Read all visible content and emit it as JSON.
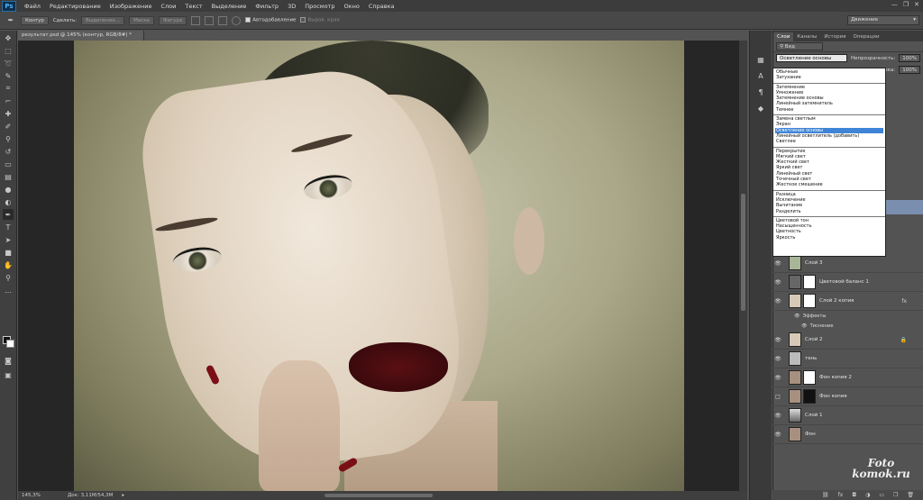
{
  "app": {
    "logo": "Ps"
  },
  "menu": [
    "Файл",
    "Редактирование",
    "Изображение",
    "Слои",
    "Текст",
    "Выделение",
    "Фильтр",
    "3D",
    "Просмотр",
    "Окно",
    "Справка"
  ],
  "window_controls": [
    "—",
    "❐",
    "✕"
  ],
  "options": {
    "mode": "Контур",
    "make_label": "Сделать:",
    "selection": "Выделение...",
    "mask": "Маска",
    "shape": "Фигура",
    "autoadd": "Автодобавление",
    "align_edges": "Выров. края",
    "workspace": "Движение"
  },
  "document": {
    "tab": "результат.psd @ 145% (контур, RGB/8#) *",
    "zoom": "145,3%",
    "doc_info": "Док: 3,11M/54,3M"
  },
  "panel": {
    "tabs": [
      "Слои",
      "Каналы",
      "История",
      "Операции"
    ],
    "filter": "Вид",
    "blend_mode": "Осветление основы",
    "opacity_label": "Непрозрачность:",
    "opacity": "100%",
    "fill_label": "Заливка:",
    "fill": "100%"
  },
  "blend_groups": [
    [
      "Обычные",
      "Затухание"
    ],
    [
      "Затемнение",
      "Умножение",
      "Затемнение основы",
      "Линейный затемнитель",
      "Темнее"
    ],
    [
      "Замена светлым",
      "Экран",
      "Осветление основы",
      "Линейный осветлитель (добавить)",
      "Светлее"
    ],
    [
      "Перекрытие",
      "Мягкий свет",
      "Жесткий свет",
      "Яркий свет",
      "Линейный свет",
      "Точечный свет",
      "Жесткое смешение"
    ],
    [
      "Разница",
      "Исключение",
      "Вычитание",
      "Разделить"
    ],
    [
      "Цветовой тон",
      "Насыщенность",
      "Цветность",
      "Яркость"
    ]
  ],
  "layers": {
    "l0": "Слой 3",
    "l1": "Цветовой баланс 1",
    "l2": "Слой 2 копия",
    "fx": "Эффекты",
    "fx1": "Тиснение",
    "l3": "Слой 2",
    "l4": "тень",
    "l5": "Фон копия 2",
    "l6": "Фон копия",
    "l7": "Слой 1",
    "l8": "Фон"
  },
  "watermark": {
    "line1": "Foto",
    "line2": "komok.ru"
  }
}
